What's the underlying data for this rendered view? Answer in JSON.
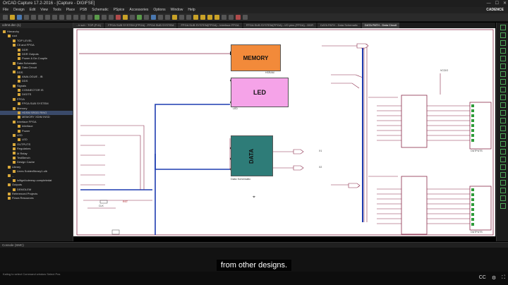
{
  "window": {
    "title": "OrCAD Capture 17.2-2016 - [Capture - DIGIFSE]",
    "controls": [
      "—",
      "☐",
      "✕"
    ],
    "version_badge": "CADENCE"
  },
  "menu": [
    "File",
    "Design",
    "Edit",
    "View",
    "Tools",
    "Place",
    "PSB",
    "Schematic",
    "PSpice",
    "Accessories",
    "Options",
    "Window",
    "Help"
  ],
  "tabs": [
    {
      "label": "...ir.sch · TOP (P:t1)"
    },
    {
      "label": "FPGA SUB SYSTEM (FPGA) - FPGA SUB SYSTEM"
    },
    {
      "label": "FPGA SUB SYSTEM(FPGA) - Interface FPGA"
    },
    {
      "label": "FPGA SUB SYSTEM(FPGA) - I/O pins (FPGA) - DDR"
    },
    {
      "label": "DATA PATH - Data Schematic"
    },
    {
      "label": "DATA PATH - Data Circuit",
      "active": true
    }
  ],
  "left_panel": {
    "title": "cdrmt.dsn (1)",
    "tree": [
      {
        "label": "Hierarchy",
        "indent": 0
      },
      {
        "label": "root",
        "indent": 1
      },
      {
        "label": "TOP LEVEL",
        "indent": 2
      },
      {
        "label": "Ctl and FPGA",
        "indent": 2
      },
      {
        "label": "DDR",
        "indent": 3
      },
      {
        "label": "DDR Outputs",
        "indent": 3
      },
      {
        "label": "Power & De-Couplin",
        "indent": 3
      },
      {
        "label": "Data Schematic",
        "indent": 2
      },
      {
        "label": "Data Circuit",
        "indent": 3
      },
      {
        "label": "DDS",
        "indent": 2
      },
      {
        "label": "ANALOGUE - IB",
        "indent": 3
      },
      {
        "label": "DDS",
        "indent": 3
      },
      {
        "label": "Signals",
        "indent": 2
      },
      {
        "label": "CONNECTOR IS",
        "indent": 3
      },
      {
        "label": "DIGITS",
        "indent": 3
      },
      {
        "label": "FPGA",
        "indent": 2
      },
      {
        "label": "FPGA SUB SYSTEM",
        "indent": 3
      },
      {
        "label": "Memory",
        "indent": 2
      },
      {
        "label": "HDSM SRDD RING",
        "indent": 3,
        "selected": true
      },
      {
        "label": "MEMORY XDIM INSD",
        "indent": 3
      },
      {
        "label": "Interface FPGA",
        "indent": 2
      },
      {
        "label": "Interface",
        "indent": 3
      },
      {
        "label": "Power",
        "indent": 3
      },
      {
        "label": "LED",
        "indent": 2
      },
      {
        "label": "LED",
        "indent": 3
      },
      {
        "label": "OUTPUTS",
        "indent": 2
      },
      {
        "label": "Regulators",
        "indent": 2
      },
      {
        "label": "M Relay",
        "indent": 2
      },
      {
        "label": "TestBench",
        "indent": 2
      },
      {
        "label": "Design Cache",
        "indent": 2
      },
      {
        "label": "Library",
        "indent": 1
      },
      {
        "label": "Lines Solder/library1.olb",
        "indent": 2
      },
      {
        "label": "...",
        "indent": 1
      },
      {
        "label": "lolltgel/cdemsp.completedat",
        "indent": 2
      },
      {
        "label": "Outputs",
        "indent": 1
      },
      {
        "label": "DEMOLEM",
        "indent": 2
      },
      {
        "label": "Referenced Projects",
        "indent": 1
      },
      {
        "label": "Flows Resources",
        "indent": 1
      }
    ]
  },
  "schematic": {
    "blocks": [
      {
        "name": "memory",
        "label": "MEMORY",
        "color": "#f28a3a"
      },
      {
        "name": "led",
        "label": "LED",
        "color": "#f5a3e8"
      },
      {
        "name": "data",
        "label": "DATA",
        "color": "#2e7c78"
      }
    ],
    "labels": {
      "data_schem": "Data Schematic",
      "hsram": "HSRAM",
      "led_pin": "LED",
      "vcc": "VCCIO",
      "outputs1": "OUTPUTS",
      "outputs2": "OUTPUTS",
      "x1": "X1",
      "x2": "X2",
      "rst": "RST",
      "clk": "CLK"
    }
  },
  "bottom_panel": {
    "title": "Console (SMC)"
  },
  "subtitle": "from other designs.",
  "status": "Kaling to select   Command window   Select Pos",
  "player": [
    "CC",
    "⚙",
    "⛶"
  ]
}
